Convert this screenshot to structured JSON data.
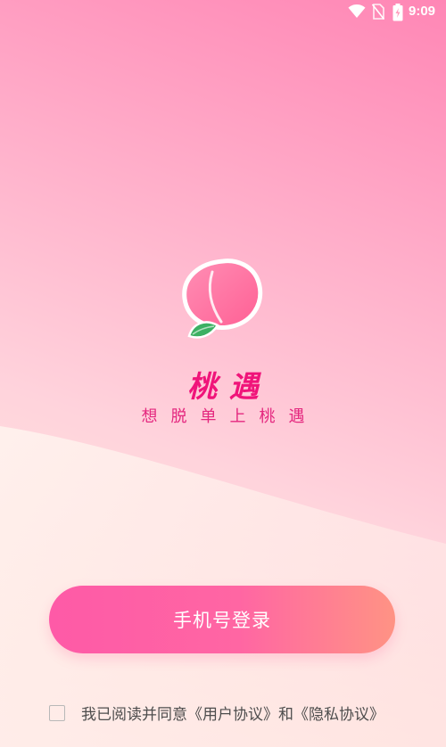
{
  "status_bar": {
    "time": "9:09",
    "icons": [
      "wifi-icon",
      "no-sim-icon",
      "battery-charging-icon"
    ]
  },
  "app": {
    "name": "桃遇",
    "slogan": "想脱单上桃遇",
    "logo_icon": "peach-icon"
  },
  "login": {
    "phone_login_label": "手机号登录"
  },
  "agreement": {
    "prefix": "我已阅读并同意",
    "user_agreement": "《用户协议》",
    "conjunction": "和",
    "privacy_policy": "《隐私协议》",
    "checked": false
  },
  "colors": {
    "brand_pink": "#f0147a",
    "button_gradient_start": "#fe5aa7",
    "button_gradient_end": "#ff9384",
    "text_gray": "#4d4d4d"
  }
}
